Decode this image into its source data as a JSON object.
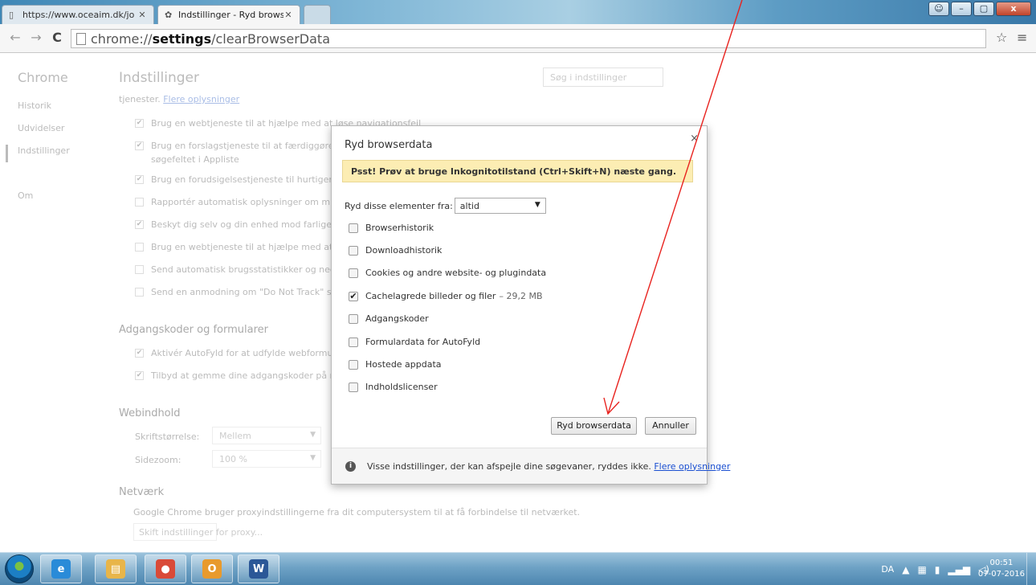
{
  "browser": {
    "tabs": [
      {
        "label": "https://www.oceaim.dk/jo",
        "icon": "page-icon"
      },
      {
        "label": "Indstillinger - Ryd browse",
        "icon": "gear-icon"
      }
    ],
    "address": {
      "prefix": "chrome://",
      "host": "settings",
      "path": "/clearBrowserData"
    },
    "window_controls": {
      "minimize": "–",
      "maximize": "▢",
      "close": "x"
    }
  },
  "sidebar": {
    "title": "Chrome",
    "items": [
      "Historik",
      "Udvidelser",
      "Indstillinger",
      "Om"
    ]
  },
  "settings": {
    "title": "Indstillinger",
    "search_placeholder": "Søg i indstillinger",
    "services_text": "tjenester.",
    "services_link": "Flere oplysninger",
    "privacy_options": [
      "Brug en webtjeneste til at hjælpe med at løse navigationsfeil",
      "Brug en forslagstjeneste til at færdiggøre søg",
      "søgefeltet i Appliste",
      "Brug en forudsigelsestjeneste til hurtigere sid",
      "Rapportér automatisk oplysninger om mulige",
      "Beskyt dig selv og din enhed mod farlige web",
      "Brug en webtjeneste til at hjælpe med at rett",
      "Send automatisk brugsstatistikker og nedbru",
      "Send en anmodning om \"Do Not Track\" sam"
    ],
    "passwords_heading": "Adgangskoder og formularer",
    "passwords_options": [
      "Aktivér AutoFyld for at udfylde webformulare",
      "Tilbyd at gemme dine adgangskoder på nette"
    ],
    "webcontent_heading": "Webindhold",
    "font_size_label": "Skriftstørrelse:",
    "font_size_value": "Mellem",
    "zoom_label": "Sidezoom:",
    "zoom_value": "100 %",
    "network_heading": "Netværk",
    "network_text": "Google Chrome bruger proxyindstillingerne fra dit computersystem til at få forbindelse til netværket.",
    "proxy_button": "Skift indstillinger for proxy..."
  },
  "dialog": {
    "title": "Ryd browserdata",
    "close": "×",
    "banner": "Psst! Prøv at bruge Inkognitotilstand (Ctrl+Skift+N) næste gang.",
    "range_label": "Ryd disse elementer fra:",
    "range_value": "altid",
    "items": [
      {
        "label": "Browserhistorik",
        "checked": false,
        "size": ""
      },
      {
        "label": "Downloadhistorik",
        "checked": false,
        "size": ""
      },
      {
        "label": "Cookies og andre website- og plugindata",
        "checked": false,
        "size": ""
      },
      {
        "label": "Cachelagrede billeder og filer",
        "checked": true,
        "size": "–  29,2 MB"
      },
      {
        "label": "Adgangskoder",
        "checked": false,
        "size": ""
      },
      {
        "label": "Formulardata for AutoFyld",
        "checked": false,
        "size": ""
      },
      {
        "label": "Hostede appdata",
        "checked": false,
        "size": ""
      },
      {
        "label": "Indholdslicenser",
        "checked": false,
        "size": ""
      }
    ],
    "clear_button": "Ryd browserdata",
    "cancel_button": "Annuller",
    "footer_text": "Visse indstillinger, der kan afspejle dine søgevaner, ryddes ikke.",
    "footer_link": "Flere oplysninger"
  },
  "annotation": {
    "color": "#e8231f"
  },
  "taskbar": {
    "apps": [
      {
        "name": "internet-explorer-icon",
        "glyph": "e",
        "color": "#2a8bd8"
      },
      {
        "name": "file-explorer-icon",
        "glyph": "▤",
        "color": "#e8b54a"
      },
      {
        "name": "chrome-icon",
        "glyph": "●",
        "color": "#d94a38"
      },
      {
        "name": "outlook-icon",
        "glyph": "O",
        "color": "#e89a2d"
      },
      {
        "name": "word-icon",
        "glyph": "W",
        "color": "#2b5797"
      }
    ],
    "language": "DA",
    "time": "00:51",
    "date": "07-07-2016"
  }
}
